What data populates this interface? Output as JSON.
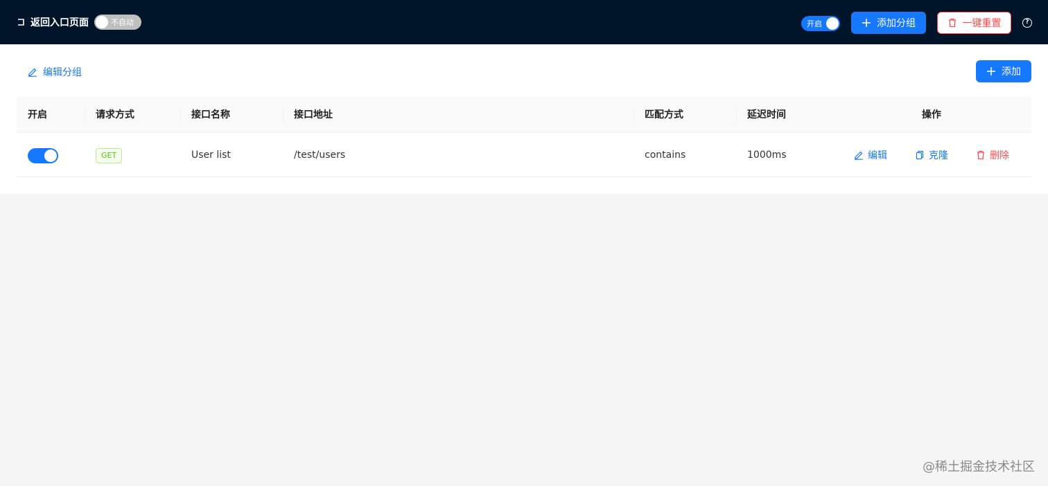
{
  "header": {
    "back_label": "返回入口页面",
    "auto_switch_label": "不自动",
    "enable_switch_label": "开启",
    "add_group_label": "添加分组",
    "reset_label": "一键重置",
    "help_symbol": "?"
  },
  "card": {
    "edit_group_label": "编辑分组",
    "add_label": "添加"
  },
  "table": {
    "columns": [
      "开启",
      "请求方式",
      "接口名称",
      "接口地址",
      "匹配方式",
      "延迟时间",
      "操作"
    ],
    "rows": [
      {
        "enabled": true,
        "method": "GET",
        "name": "User list",
        "path": "/test/users",
        "match": "contains",
        "delay": "1000ms",
        "actions": [
          "编辑",
          "克隆",
          "删除"
        ]
      }
    ]
  },
  "watermark": "@稀土掘金技术社区",
  "colors": {
    "header_bg": "#001529",
    "primary": "#1677ff",
    "danger": "#ff4d4f",
    "tag_green": "#52c41a"
  }
}
